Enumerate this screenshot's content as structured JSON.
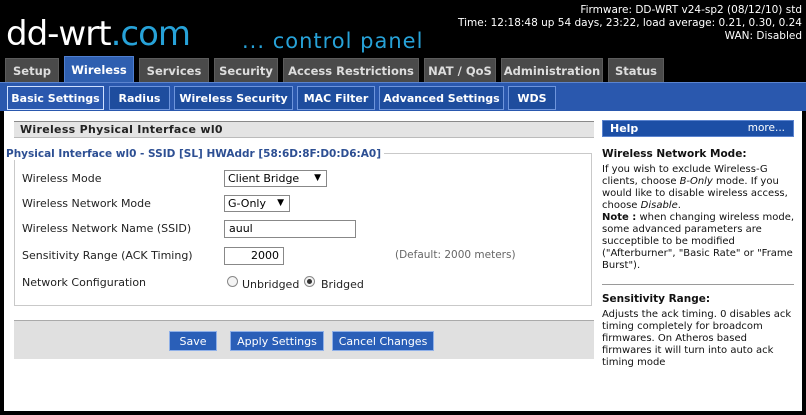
{
  "header": {
    "logo_main": "dd-wrt",
    "logo_suffix": ".com",
    "subtitle": "... control panel",
    "firmware": "Firmware: DD-WRT v24-sp2 (08/12/10) std",
    "time": "Time: 12:18:48 up 54 days, 23:22, load average: 0.21, 0.30, 0.24",
    "wan": "WAN: Disabled"
  },
  "main_tabs": [
    "Setup",
    "Wireless",
    "Services",
    "Security",
    "Access Restrictions",
    "NAT / QoS",
    "Administration",
    "Status"
  ],
  "active_main_tab": "Wireless",
  "sub_tabs": [
    "Basic Settings",
    "Radius",
    "Wireless Security",
    "MAC Filter",
    "Advanced Settings",
    "WDS"
  ],
  "active_sub_tab": "Basic Settings",
  "panel": {
    "title": "Wireless Physical Interface wl0",
    "legend": "Physical Interface wl0 - SSID [SL] HWAddr [58:6D:8F:D0:D6:A0]",
    "wireless_mode_label": "Wireless Mode",
    "wireless_mode_value": "Client Bridge",
    "network_mode_label": "Wireless Network Mode",
    "network_mode_value": "G-Only",
    "ssid_label": "Wireless Network Name (SSID)",
    "ssid_value": "auul",
    "sensitivity_label": "Sensitivity Range (ACK Timing)",
    "sensitivity_value": "2000",
    "sensitivity_hint": "(Default: 2000 meters)",
    "netconfig_label": "Network Configuration",
    "netconfig_options": [
      "Unbridged",
      "Bridged"
    ],
    "netconfig_selected": "Bridged"
  },
  "buttons": {
    "save": "Save",
    "apply": "Apply Settings",
    "cancel": "Cancel Changes"
  },
  "help": {
    "title": "Help",
    "more": "more...",
    "mode_heading": "Wireless Network Mode:",
    "mode_text_1": "If you wish to exclude Wireless-G clients, choose ",
    "mode_text_em1": "B-Only",
    "mode_text_2": " mode. If you would like to disable wireless access, choose ",
    "mode_text_em2": "Disable",
    "mode_text_3": ".",
    "note_label": "Note :",
    "note_text": " when changing wireless mode, some advanced parameters are succeptible to be modified (\"Afterburner\", \"Basic Rate\" or \"Frame Burst\").",
    "sens_heading": "Sensitivity Range:",
    "sens_text": "Adjusts the ack timing. 0 disables ack timing completely for broadcom firmwares. On Atheros based firmwares it will turn into auto ack timing mode"
  },
  "colors": {
    "accent": "#2a58ae",
    "logo_accent": "#27a2d8",
    "tab_inactive": "#4a4a4a"
  }
}
